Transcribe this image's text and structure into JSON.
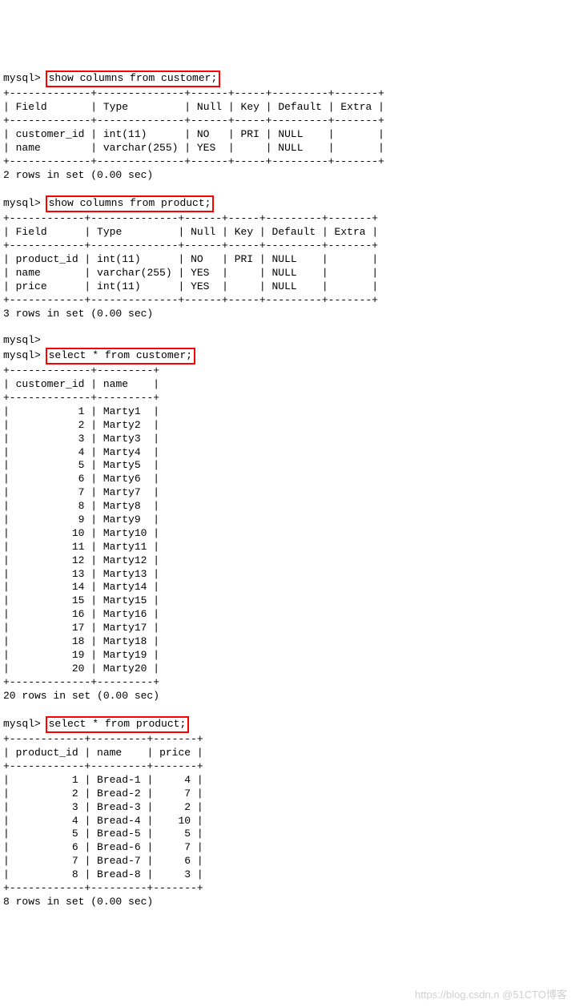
{
  "prompt": "mysql>",
  "emptyPrompt": "mysql>",
  "commands": {
    "c1": "show columns from customer;",
    "c2": "show columns from product;",
    "c3": "select * from customer;",
    "c4": "select * from product;"
  },
  "tables": {
    "customerSchema": {
      "headers": [
        "Field",
        "Type",
        "Null",
        "Key",
        "Default",
        "Extra"
      ],
      "rows": [
        {
          "field": "customer_id",
          "type": "int(11)",
          "null": "NO",
          "key": "PRI",
          "default": "NULL",
          "extra": ""
        },
        {
          "field": "name",
          "type": "varchar(255)",
          "null": "YES",
          "key": "",
          "default": "NULL",
          "extra": ""
        }
      ],
      "footer": "2 rows in set (0.00 sec)"
    },
    "productSchema": {
      "headers": [
        "Field",
        "Type",
        "Null",
        "Key",
        "Default",
        "Extra"
      ],
      "rows": [
        {
          "field": "product_id",
          "type": "int(11)",
          "null": "NO",
          "key": "PRI",
          "default": "NULL",
          "extra": ""
        },
        {
          "field": "name",
          "type": "varchar(255)",
          "null": "YES",
          "key": "",
          "default": "NULL",
          "extra": ""
        },
        {
          "field": "price",
          "type": "int(11)",
          "null": "YES",
          "key": "",
          "default": "NULL",
          "extra": ""
        }
      ],
      "footer": "3 rows in set (0.00 sec)"
    },
    "customerData": {
      "headers": [
        "customer_id",
        "name"
      ],
      "rows": [
        {
          "id": "1",
          "name": "Marty1"
        },
        {
          "id": "2",
          "name": "Marty2"
        },
        {
          "id": "3",
          "name": "Marty3"
        },
        {
          "id": "4",
          "name": "Marty4"
        },
        {
          "id": "5",
          "name": "Marty5"
        },
        {
          "id": "6",
          "name": "Marty6"
        },
        {
          "id": "7",
          "name": "Marty7"
        },
        {
          "id": "8",
          "name": "Marty8"
        },
        {
          "id": "9",
          "name": "Marty9"
        },
        {
          "id": "10",
          "name": "Marty10"
        },
        {
          "id": "11",
          "name": "Marty11"
        },
        {
          "id": "12",
          "name": "Marty12"
        },
        {
          "id": "13",
          "name": "Marty13"
        },
        {
          "id": "14",
          "name": "Marty14"
        },
        {
          "id": "15",
          "name": "Marty15"
        },
        {
          "id": "16",
          "name": "Marty16"
        },
        {
          "id": "17",
          "name": "Marty17"
        },
        {
          "id": "18",
          "name": "Marty18"
        },
        {
          "id": "19",
          "name": "Marty19"
        },
        {
          "id": "20",
          "name": "Marty20"
        }
      ],
      "footer": "20 rows in set (0.00 sec)"
    },
    "productData": {
      "headers": [
        "product_id",
        "name",
        "price"
      ],
      "rows": [
        {
          "id": "1",
          "name": "Bread-1",
          "price": "4"
        },
        {
          "id": "2",
          "name": "Bread-2",
          "price": "7"
        },
        {
          "id": "3",
          "name": "Bread-3",
          "price": "2"
        },
        {
          "id": "4",
          "name": "Bread-4",
          "price": "10"
        },
        {
          "id": "5",
          "name": "Bread-5",
          "price": "5"
        },
        {
          "id": "6",
          "name": "Bread-6",
          "price": "7"
        },
        {
          "id": "7",
          "name": "Bread-7",
          "price": "6"
        },
        {
          "id": "8",
          "name": "Bread-8",
          "price": "3"
        }
      ],
      "footer": "8 rows in set (0.00 sec)"
    }
  },
  "watermark": "https://blog.csdn.n @51CTO博客"
}
